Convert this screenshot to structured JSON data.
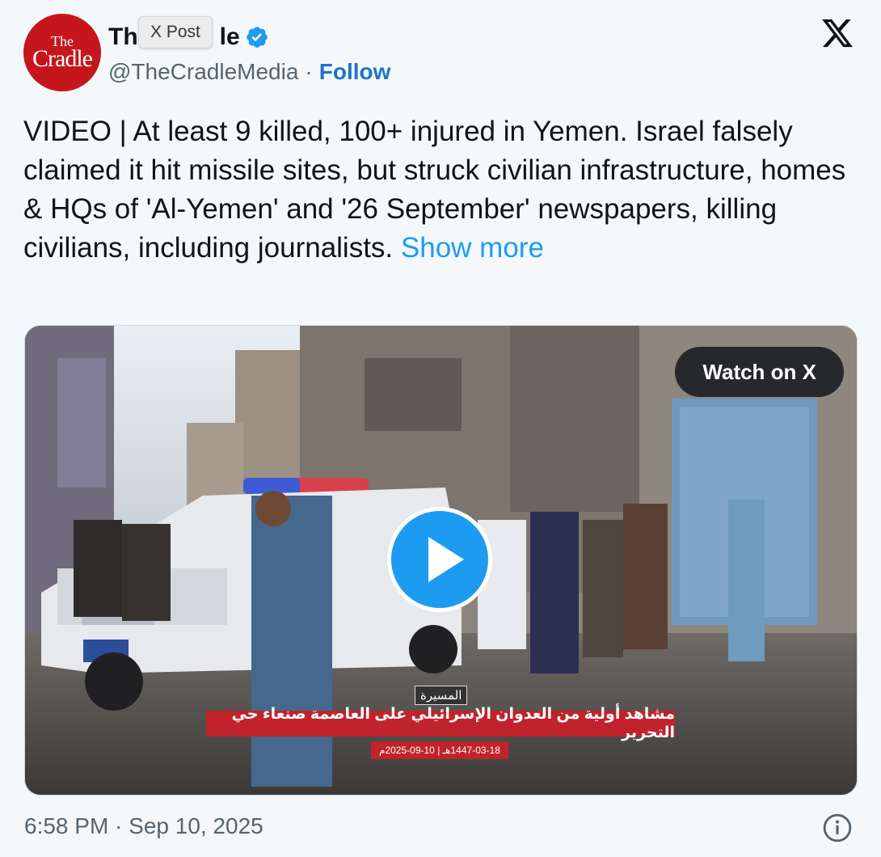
{
  "author": {
    "avatar_text_line1": "The",
    "avatar_text_line2": "Cradle",
    "display_name_start": "Th",
    "display_name_end": "le",
    "handle": "@TheCradleMedia",
    "separator": "·",
    "follow_label": "Follow",
    "verified_icon": "verified-badge-icon",
    "verified_color": "#1d9bf0"
  },
  "tooltip": {
    "label": "X Post"
  },
  "brand": {
    "logo_icon": "x-logo-icon"
  },
  "post": {
    "text": "VIDEO | At least 9 killed, 100+ injured in Yemen. Israel falsely claimed it hit missile sites, but struck civilian infrastructure, homes & HQs of 'Al-Yemen' and '26 September' newspapers, killing civilians, including journalists. ",
    "show_more": "Show more",
    "link_color": "#1d9bf0"
  },
  "media": {
    "watch_label": "Watch on X",
    "play_icon": "play-icon",
    "caption_logo": "المسيرة",
    "caption_main": "مشاهد أولية من العدوان الإسرائيلي على العاصمة صنعاء حي التحرير",
    "caption_date": "1447-03-18هـ | 10-09-2025م"
  },
  "footer": {
    "timestamp": "6:58 PM · Sep 10, 2025",
    "info_icon": "info-icon"
  }
}
